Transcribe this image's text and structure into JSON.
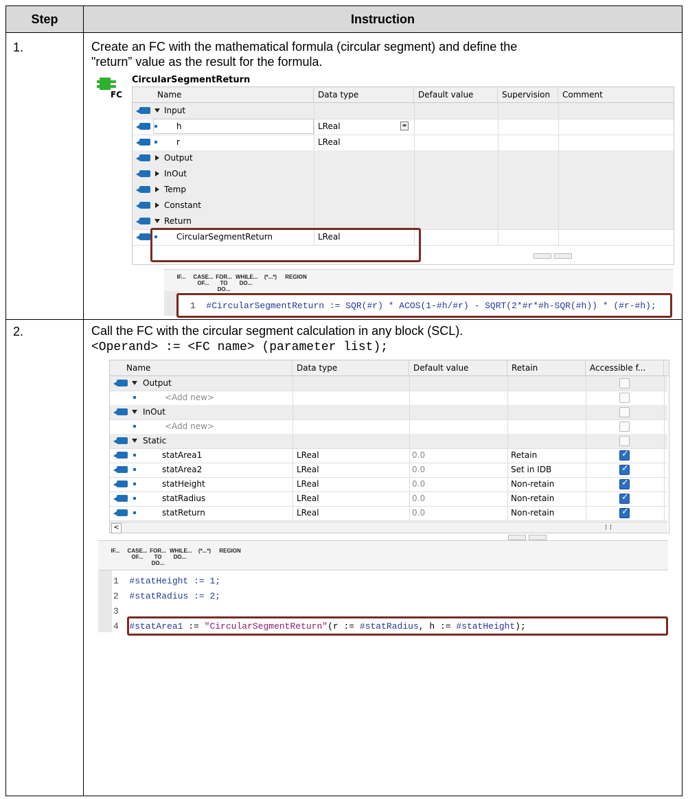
{
  "table": {
    "headers": {
      "step": "Step",
      "instruction": "Instruction"
    }
  },
  "step1": {
    "number": "1.",
    "text_line1": "Create an FC with the mathematical formula (circular segment) and define the",
    "text_line2": "\"return” value as the result for the formula.",
    "block_name": "CircularSegmentReturn",
    "fc_label": "FC",
    "columns": [
      "Name",
      "Data type",
      "Default value",
      "Supervision",
      "Comment"
    ],
    "rows": [
      {
        "name": "Input",
        "type": "",
        "kind": "section-open"
      },
      {
        "name": "h",
        "type": "LReal",
        "kind": "item"
      },
      {
        "name": "r",
        "type": "LReal",
        "kind": "item"
      },
      {
        "name": "Output",
        "type": "",
        "kind": "section-closed"
      },
      {
        "name": "InOut",
        "type": "",
        "kind": "section-closed"
      },
      {
        "name": "Temp",
        "type": "",
        "kind": "section-closed"
      },
      {
        "name": "Constant",
        "type": "",
        "kind": "section-closed"
      },
      {
        "name": "Return",
        "type": "",
        "kind": "section-open"
      },
      {
        "name": "CircularSegmentReturn",
        "type": "LReal",
        "kind": "item"
      }
    ],
    "toolbar": [
      "IF...",
      "CASE... OF...",
      "FOR... TO DO...",
      "WHILE... DO...",
      "(*...*)",
      "REGION"
    ],
    "code": {
      "line_no": "1",
      "lhs": "#CircularSegmentReturn",
      "rest": " := SQR(#r) * ACOS(1-#h/#r) - SQRT(2*#r*#h-SQR(#h)) * (#r-#h);"
    }
  },
  "step2": {
    "number": "2.",
    "text": "Call the FC with the circular segment calculation in any block (SCL).",
    "syntax": "<Operand> := <FC name> (parameter list);",
    "columns": [
      "Name",
      "Data type",
      "Default value",
      "Retain",
      "Accessible f..."
    ],
    "rows": [
      {
        "name": "Output",
        "type": "",
        "default": "",
        "retain": "",
        "kind": "section-open",
        "access": false
      },
      {
        "name": "<Add new>",
        "type": "",
        "default": "",
        "retain": "",
        "kind": "addnew",
        "access": false
      },
      {
        "name": "InOut",
        "type": "",
        "default": "",
        "retain": "",
        "kind": "section-open",
        "access": false
      },
      {
        "name": "<Add new>",
        "type": "",
        "default": "",
        "retain": "",
        "kind": "addnew",
        "access": false
      },
      {
        "name": "Static",
        "type": "",
        "default": "",
        "retain": "",
        "kind": "section-open",
        "access": false
      },
      {
        "name": "statArea1",
        "type": "LReal",
        "default": "0.0",
        "retain": "Retain",
        "kind": "item",
        "access": true
      },
      {
        "name": "statArea2",
        "type": "LReal",
        "default": "0.0",
        "retain": "Set in IDB",
        "kind": "item",
        "access": true
      },
      {
        "name": "statHeight",
        "type": "LReal",
        "default": "0.0",
        "retain": "Non-retain",
        "kind": "item",
        "access": true
      },
      {
        "name": "statRadius",
        "type": "LReal",
        "default": "0.0",
        "retain": "Non-retain",
        "kind": "item",
        "access": true
      },
      {
        "name": "statReturn",
        "type": "LReal",
        "default": "0.0",
        "retain": "Non-retain",
        "kind": "item",
        "access": true
      }
    ],
    "toolbar": [
      "IF...",
      "CASE... OF...",
      "FOR... TO DO...",
      "WHILE... DO...",
      "(*...*)",
      "REGION"
    ],
    "code_lines": [
      {
        "n": "1",
        "text": "#statHeight := 1;"
      },
      {
        "n": "2",
        "text": "#statRadius := 2;"
      },
      {
        "n": "3",
        "text": ""
      }
    ],
    "code_line4": {
      "n": "4",
      "lhs": "#statArea1",
      "assign": " := ",
      "fc": "\"CircularSegmentReturn\"",
      "args_open": "(r := ",
      "arg1": "#statRadius",
      "mid": ", h := ",
      "arg2": "#statHeight",
      "close": ");"
    }
  }
}
